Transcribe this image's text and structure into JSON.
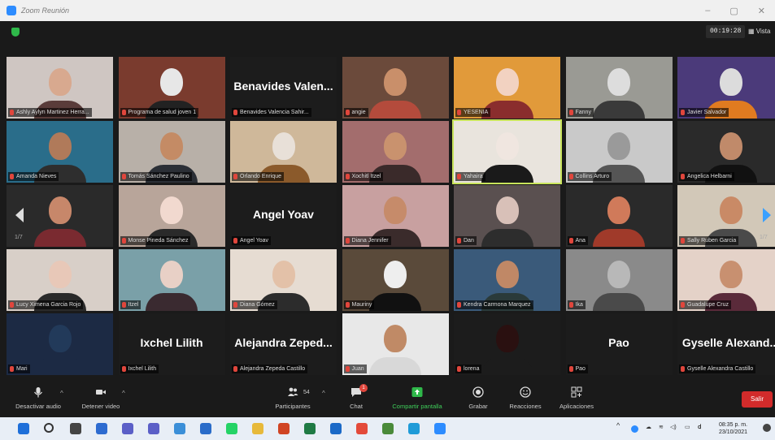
{
  "window": {
    "title": "Zoom Reunión"
  },
  "topbar": {
    "timer": "00:19:28",
    "view_label": "Vista"
  },
  "colors": {
    "accent_green": "#2fb84a",
    "active_speaker": "#c8e35b",
    "leave_red": "#d22b2b",
    "muted_red": "#e0463c"
  },
  "pagination": {
    "left": "1/7",
    "right": "1/7"
  },
  "participants": [
    {
      "label": "Ashly Aylyn Martinez Herra...",
      "video": true,
      "bg": "#cfc6c2",
      "skin": "#d8a98f",
      "cloth": "#5a3c3a"
    },
    {
      "label": "Programa de salud joven 1",
      "video": true,
      "bg": "#7a3b2e",
      "skin": "#e7e7e7",
      "cloth": "#222"
    },
    {
      "label": "Benavides Valencia Sahir...",
      "big": "Benavides Valen...",
      "video": false
    },
    {
      "label": "angie",
      "video": true,
      "bg": "#6b4a3b",
      "skin": "#c98f6a",
      "cloth": "#b44b3c"
    },
    {
      "label": "YESENIA",
      "video": true,
      "bg": "#e19a3a",
      "skin": "#f2d2c1",
      "cloth": "#8a2d2d"
    },
    {
      "label": "Fanny",
      "video": true,
      "bg": "#9a9a94",
      "skin": "#ddd",
      "cloth": "#3a3a3a"
    },
    {
      "label": "Javier Salvador",
      "video": true,
      "bg": "#4b3a7a",
      "skin": "#dcdcdc",
      "cloth": "#e07b20"
    },
    {
      "label": "Amanda Nieves",
      "video": true,
      "bg": "#2a6d8a",
      "skin": "#b07a5a",
      "cloth": "#2e2e2e"
    },
    {
      "label": "Tomás Sánchez Paulino",
      "video": true,
      "bg": "#b8b0a8",
      "skin": "#c48b65",
      "cloth": "#2b2f36"
    },
    {
      "label": "Orlando Enrique",
      "video": true,
      "bg": "#cfb89a",
      "skin": "#e8e0d8",
      "cloth": "#8b5a2b"
    },
    {
      "label": "Xochitl Itzel",
      "video": true,
      "bg": "#a36d6d",
      "skin": "#c9926e",
      "cloth": "#3a2a2a"
    },
    {
      "label": "Yahaira",
      "video": true,
      "talking": true,
      "bg": "#e9e4dd",
      "skin": "#f0e6e0",
      "cloth": "#1a1a1a"
    },
    {
      "label": "Collins Arturo",
      "video": true,
      "bg": "#c9c9c9",
      "skin": "#9a9a9a",
      "cloth": "#555"
    },
    {
      "label": "Angelica Helbarni",
      "video": true,
      "bg": "#2a2a2a",
      "skin": "#c08a6a",
      "cloth": "#111"
    },
    {
      "label": "",
      "video": true,
      "bg": "#2a2a2a",
      "skin": "#c7876a",
      "cloth": "#7a2a30"
    },
    {
      "label": "Monse Pineda Sánchez",
      "video": true,
      "bg": "#b8a59a",
      "skin": "#f1d9cf",
      "cloth": "#2a2a2a"
    },
    {
      "label": "Angel Yoav",
      "big": "Angel Yoav",
      "video": false
    },
    {
      "label": "Diana Jennifer",
      "video": true,
      "bg": "#c8a0a0",
      "skin": "#c68b6a",
      "cloth": "#3a2b2b"
    },
    {
      "label": "Dan",
      "video": true,
      "bg": "#5a5050",
      "skin": "#d8c0b8",
      "cloth": "#2d2d2d"
    },
    {
      "label": "Ana",
      "video": true,
      "bg": "#2a2a2a",
      "skin": "#d07a5a",
      "cloth": "#a03a2a"
    },
    {
      "label": "Sally Ruben Garcia",
      "video": true,
      "bg": "#d2c8b8",
      "skin": "#c98a66",
      "cloth": "#4a4a4a"
    },
    {
      "label": "Lucy Ximena Garcia Rojo",
      "video": true,
      "bg": "#d8cfc8",
      "skin": "#e8c8b8",
      "cloth": "#2a2a2a"
    },
    {
      "label": "Itzel",
      "video": true,
      "bg": "#7aa0a8",
      "skin": "#e8d0c6",
      "cloth": "#3a2a30"
    },
    {
      "label": "Diana Gómez",
      "video": true,
      "bg": "#e6dcd2",
      "skin": "#e3c1a8",
      "cloth": "#2c2c2c"
    },
    {
      "label": "Mauriny",
      "video": true,
      "bg": "#5a4a3a",
      "skin": "#eeeeee",
      "cloth": "#111"
    },
    {
      "label": "Kendra Carmona Marquez",
      "video": true,
      "bg": "#3a5a7a",
      "skin": "#c08866",
      "cloth": "#2a3a3a"
    },
    {
      "label": "Ika",
      "video": true,
      "bg": "#8a8a8a",
      "skin": "#b8b8b8",
      "cloth": "#4a4a4a"
    },
    {
      "label": "Guadalupe Cruz",
      "video": true,
      "bg": "#e4d2c8",
      "skin": "#c89070",
      "cloth": "#5a2a3a"
    },
    {
      "label": "Mari",
      "video": true,
      "bg": "#1c2a44",
      "skin": "#223a5a",
      "cloth": "#1c2a44"
    },
    {
      "label": "Ixchel Lilith",
      "big": "Ixchel Lilith",
      "video": false
    },
    {
      "label": "Alejandra Zepeda Castillo",
      "big": "Alejandra Zeped...",
      "video": false
    },
    {
      "label": "Juan",
      "video": true,
      "bg": "#e8e8e8",
      "skin": "#c08a66",
      "cloth": "#d8d8d8"
    },
    {
      "label": "lorena",
      "video": true,
      "bg": "#1c1c1c",
      "skin": "#2a1010",
      "cloth": "#1c1c1c",
      "dark": true
    },
    {
      "label": "Pao",
      "big": "Pao",
      "video": false
    },
    {
      "label": "Gyselle Alexandra Castillo",
      "big": "Gyselle Alexand...",
      "video": false
    }
  ],
  "toolbar": {
    "mute": "Desactivar audio",
    "video": "Detener video",
    "participants": "Participantes",
    "participants_count": "54",
    "chat": "Chat",
    "chat_badge": "1",
    "share": "Compartir pantalla",
    "record": "Grabar",
    "reactions": "Reacciones",
    "apps": "Aplicaciones",
    "leave": "Salir"
  },
  "taskbar": {
    "apps": [
      {
        "icon": "windows-start-icon",
        "color": "#1e6fd9"
      },
      {
        "icon": "search-icon",
        "color": "#333333"
      },
      {
        "icon": "task-view-icon",
        "color": "#444444"
      },
      {
        "icon": "widgets-icon",
        "color": "#2d6bd0"
      },
      {
        "icon": "chat-icon",
        "color": "#5b5fc7"
      },
      {
        "icon": "teams-icon",
        "color": "#5b5fc7"
      },
      {
        "icon": "desktop-icon",
        "color": "#3b8fd8"
      },
      {
        "icon": "store-icon",
        "color": "#2a6cc9"
      },
      {
        "icon": "whatsapp-icon",
        "color": "#25d366"
      },
      {
        "icon": "file-explorer-icon",
        "color": "#e7b93a"
      },
      {
        "icon": "powerpoint-icon",
        "color": "#d04423"
      },
      {
        "icon": "excel-icon",
        "color": "#1f7a44"
      },
      {
        "icon": "outlook-icon",
        "color": "#1a69c7"
      },
      {
        "icon": "chrome-icon",
        "color": "#e34a3a"
      },
      {
        "icon": "chrome-alt-icon",
        "color": "#4a8a3a"
      },
      {
        "icon": "edge-icon",
        "color": "#1f9bd8"
      },
      {
        "icon": "zoom-icon",
        "color": "#2d8cff"
      }
    ],
    "time": "08:35 p. m.",
    "date": "23/10/2021"
  }
}
